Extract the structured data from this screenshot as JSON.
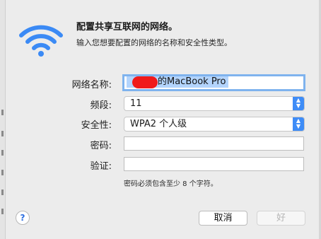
{
  "dialog": {
    "title": "配置共享互联网的网络。",
    "subtitle": "输入您想要配置的网络的名称和安全性类型。"
  },
  "form": {
    "network_name_label": "网络名称:",
    "network_name_value": "的MacBook Pro",
    "channel_label": "频段:",
    "channel_value": "11",
    "security_label": "安全性:",
    "security_value": "WPA2 个人级",
    "password_label": "密码:",
    "password_value": "",
    "verify_label": "验证:",
    "verify_value": "",
    "password_hint": "密码必须包含至少 8 个字符。"
  },
  "buttons": {
    "help_label": "?",
    "cancel_label": "取消",
    "ok_label": "好"
  },
  "colors": {
    "accent": "#3e8cf7",
    "wifi_icon": "#3b8af5",
    "redaction": "#f01a1a"
  },
  "icons": {
    "dialog_icon": "wifi-icon",
    "stepper": "chevron-up-down-icon"
  }
}
